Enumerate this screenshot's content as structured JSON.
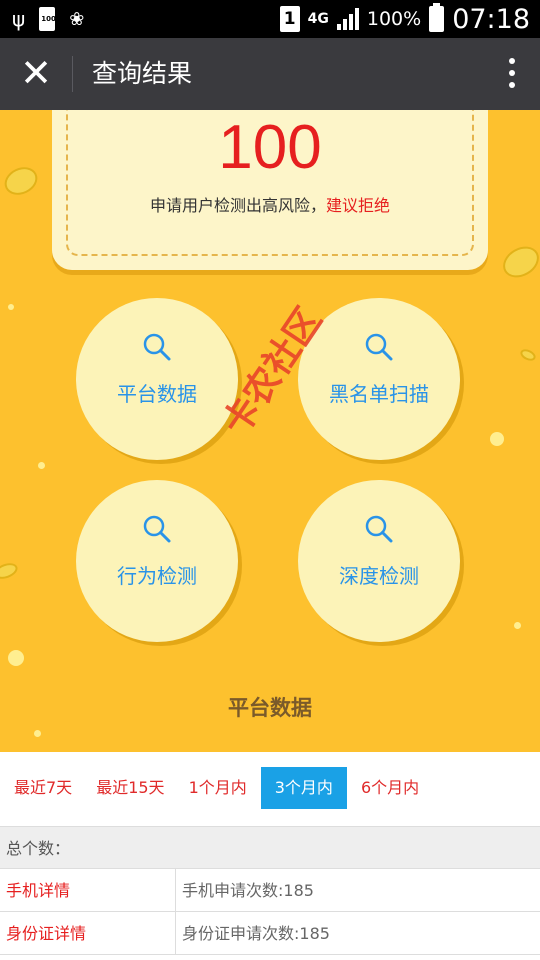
{
  "status_bar": {
    "battery_mini_label": "100",
    "sim_label": "1",
    "network": "4G",
    "battery_percent": "100%",
    "time": "07:18"
  },
  "title_bar": {
    "title": "查询结果"
  },
  "score": {
    "value": "100",
    "message": "申请用户检测出高风险，",
    "advice": "建议拒绝"
  },
  "modules": [
    {
      "label": "平台数据",
      "icon": "search-icon"
    },
    {
      "label": "黑名单扫描",
      "icon": "search-icon"
    },
    {
      "label": "行为检测",
      "icon": "search-icon"
    },
    {
      "label": "深度检测",
      "icon": "search-icon"
    }
  ],
  "watermark": "卡农社区",
  "section_title": "平台数据",
  "tabs": [
    {
      "label": "最近7天",
      "active": false
    },
    {
      "label": "最近15天",
      "active": false
    },
    {
      "label": "1个月内",
      "active": false
    },
    {
      "label": "3个月内",
      "active": true
    },
    {
      "label": "6个月内",
      "active": false
    }
  ],
  "table": {
    "header": "总个数：",
    "rows": [
      {
        "key": "手机详情",
        "value": "手机申请次数:185"
      },
      {
        "key": "身份证详情",
        "value": "身份证申请次数:185"
      }
    ]
  },
  "colors": {
    "accent_blue": "#1aa1e6",
    "warning_red": "#e61f1f",
    "panel_yellow": "#fdc12e"
  }
}
